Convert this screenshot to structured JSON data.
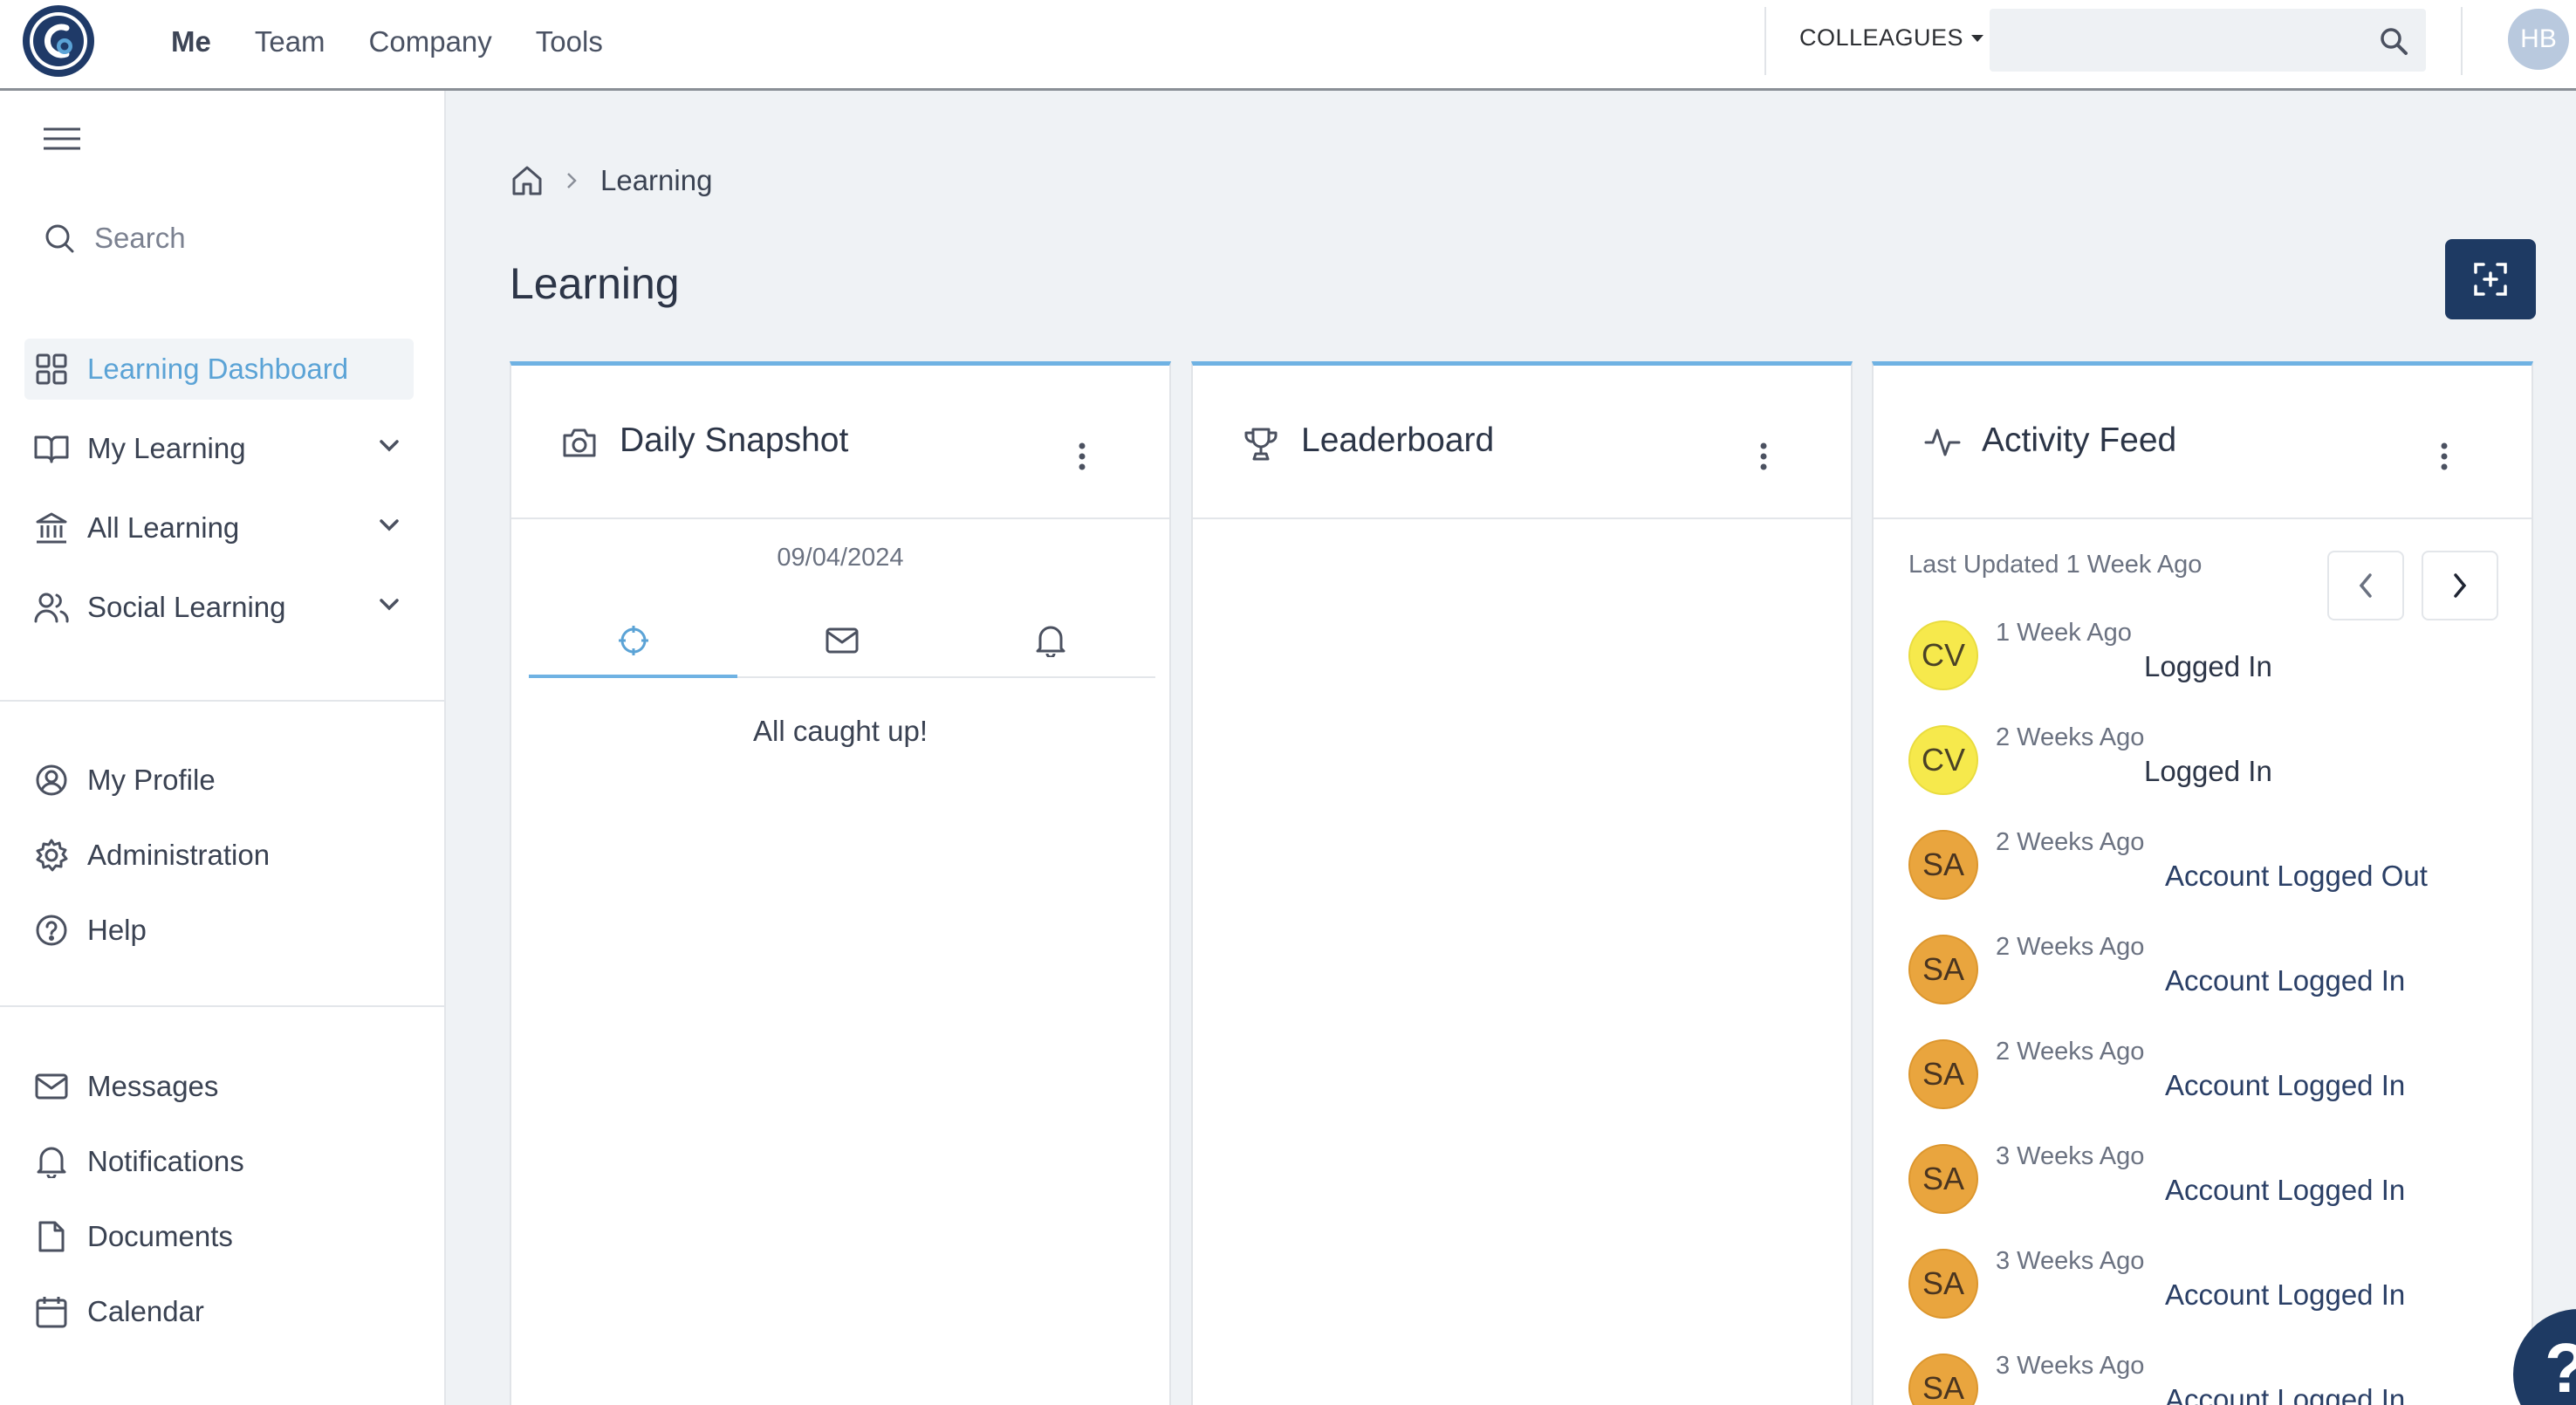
{
  "topbar": {
    "nav": [
      "Me",
      "Team",
      "Company",
      "Tools"
    ],
    "colleagues_label": "COLLEAGUES",
    "search_value": "",
    "user_initials": "HB"
  },
  "sidebar": {
    "search_placeholder": "Search",
    "primary": [
      {
        "label": "Learning Dashboard",
        "icon": "grid-icon"
      },
      {
        "label": "My Learning",
        "icon": "book-open-icon"
      },
      {
        "label": "All Learning",
        "icon": "library-icon"
      },
      {
        "label": "Social Learning",
        "icon": "users-icon"
      }
    ],
    "secondary": [
      {
        "label": "My Profile",
        "icon": "user-circle-icon"
      },
      {
        "label": "Administration",
        "icon": "gear-icon"
      },
      {
        "label": "Help",
        "icon": "help-circle-icon"
      }
    ],
    "tertiary": [
      {
        "label": "Messages",
        "icon": "mail-icon"
      },
      {
        "label": "Notifications",
        "icon": "bell-icon"
      },
      {
        "label": "Documents",
        "icon": "document-icon"
      },
      {
        "label": "Calendar",
        "icon": "calendar-icon"
      }
    ]
  },
  "breadcrumb": {
    "current": "Learning"
  },
  "page": {
    "title": "Learning"
  },
  "cards": {
    "snapshot": {
      "title": "Daily Snapshot",
      "date": "09/04/2024",
      "empty": "All caught up!"
    },
    "leaderboard": {
      "title": "Leaderboard"
    },
    "activity": {
      "title": "Activity Feed",
      "updated": "Last Updated 1 Week Ago",
      "items": [
        {
          "initials": "CV",
          "time": "1 Week Ago",
          "action": "Logged In"
        },
        {
          "initials": "CV",
          "time": "2 Weeks Ago",
          "action": "Logged In"
        },
        {
          "initials": "SA",
          "time": "2 Weeks Ago",
          "action": "Account Logged Out"
        },
        {
          "initials": "SA",
          "time": "2 Weeks Ago",
          "action": "Account Logged In"
        },
        {
          "initials": "SA",
          "time": "2 Weeks Ago",
          "action": "Account Logged In"
        },
        {
          "initials": "SA",
          "time": "3 Weeks Ago",
          "action": "Account Logged In"
        },
        {
          "initials": "SA",
          "time": "3 Weeks Ago",
          "action": "Account Logged In"
        },
        {
          "initials": "SA",
          "time": "3 Weeks Ago",
          "action": "Account Logged In"
        }
      ]
    }
  },
  "colors": {
    "accent": "#5ba3d6",
    "brand": "#1e3a63",
    "cv": "#f6e94c",
    "sa": "#e9a53e"
  }
}
